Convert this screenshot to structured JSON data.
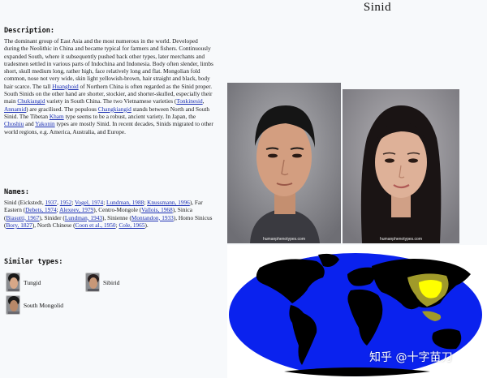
{
  "page": {
    "title": "Sinid"
  },
  "description": {
    "heading": "Description:",
    "parts": [
      {
        "t": "The dominant group of East Asia and the most numerous in the world. Developed during the Neolithic in China and became typical for farmers and fishers. Continuously expanded South, where it subsequently pushed back other types, later merchants and tradesmen settled in various parts of Indochina and Indonesia. Body often slender, limbs short, skull medium long, rather high, face relatively long and flat. Mongolian fold common, nose not very wide, skin light yellowish-brown, hair straight and black, body hair scarce. The tall "
      },
      {
        "a": "Huanghoid"
      },
      {
        "t": " of Northern China is often regarded as the Sinid proper. South Sinids on the other hand are shorter, stockier, and shorter-skulled, especially their main "
      },
      {
        "a": "Chukiangid"
      },
      {
        "t": " variety in South China. The two Vietnamese varieties ("
      },
      {
        "a": "Tonkinesid"
      },
      {
        "t": ", "
      },
      {
        "a": "Annamid"
      },
      {
        "t": ") are gracilised. The populous "
      },
      {
        "a": "Changkiangid"
      },
      {
        "t": " stands between North and South Sinid. The Tibetan "
      },
      {
        "a": "Kham"
      },
      {
        "t": " type seems to be a robust, ancient variety. In Japan, the "
      },
      {
        "a": "Choshiu"
      },
      {
        "t": " and "
      },
      {
        "a": "Yakonin"
      },
      {
        "t": " types are mostly Sinid. In recent decades, Sinids migrated to other world regions, e.g. America, Australia, and Europe."
      }
    ]
  },
  "names": {
    "heading": "Names:",
    "parts": [
      {
        "t": "Sinid (Eickstedt, "
      },
      {
        "a": "1937"
      },
      {
        "t": ", "
      },
      {
        "a": "1952"
      },
      {
        "t": "; "
      },
      {
        "a": "Vogel, 1974"
      },
      {
        "t": "; "
      },
      {
        "a": "Lundman, 1988"
      },
      {
        "t": "; "
      },
      {
        "a": "Knussmann, 1996"
      },
      {
        "t": "), Far Eastern ("
      },
      {
        "a": "Debets, 1974"
      },
      {
        "t": "; "
      },
      {
        "a": "Alexeev, 1979"
      },
      {
        "t": "), Centro-Mongole ("
      },
      {
        "a": "Vallois, 1968"
      },
      {
        "t": "), Sinica ("
      },
      {
        "a": "Biasutti, 1967"
      },
      {
        "t": "), Sinider ("
      },
      {
        "a": "Lundman, 1943"
      },
      {
        "t": "), Sinienne ("
      },
      {
        "a": "Montandon, 1933"
      },
      {
        "t": "), Homo Sinicus ("
      },
      {
        "a": "Bory, 1827"
      },
      {
        "t": "), North Chinese ("
      },
      {
        "a": "Coon et al., 1950"
      },
      {
        "t": "; "
      },
      {
        "a": "Cole, 1965"
      },
      {
        "t": ")."
      }
    ]
  },
  "similar": {
    "heading": "Similar types:",
    "items": [
      {
        "label": "Tungid"
      },
      {
        "label": "Sibirid"
      },
      {
        "label": "South Mongolid"
      }
    ]
  },
  "photos": {
    "male_credit": "humanphenotypes.com",
    "female_credit": "humanphenotypes.com"
  },
  "colors": {
    "link": "#1b2fb3",
    "ocean": "#0a22ee",
    "land": "#000000",
    "range_core": "#ffff00",
    "range_outer": "#a09a2a"
  },
  "watermark": "知乎 @十字苗刀"
}
